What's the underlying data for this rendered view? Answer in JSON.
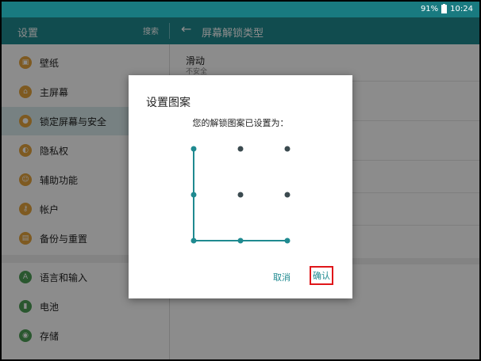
{
  "status": {
    "battery": "91%",
    "time": "10:24"
  },
  "topbar": {
    "title": "设置",
    "search": "搜索",
    "back_icon": "←",
    "page_title": "屏幕解锁类型"
  },
  "sidebar": {
    "items": [
      {
        "label": "壁纸",
        "icon": "wallpaper-icon",
        "color": "#e5a43c"
      },
      {
        "label": "主屏幕",
        "icon": "home-icon",
        "color": "#e5a43c"
      },
      {
        "label": "锁定屏幕与安全",
        "icon": "lock-icon",
        "color": "#e5a43c",
        "selected": true
      },
      {
        "label": "隐私权",
        "icon": "privacy-icon",
        "color": "#e5a43c"
      },
      {
        "label": "辅助功能",
        "icon": "accessibility-icon",
        "color": "#e5a43c"
      },
      {
        "label": "帐户",
        "icon": "key-icon",
        "color": "#e5a43c"
      },
      {
        "label": "备份与重置",
        "icon": "backup-icon",
        "color": "#e5a43c"
      },
      {
        "label": "语言和输入",
        "icon": "language-icon",
        "color": "#4d9e56"
      },
      {
        "label": "电池",
        "icon": "battery-icon",
        "color": "#4d9e56"
      },
      {
        "label": "存储",
        "icon": "storage-icon",
        "color": "#4d9e56"
      }
    ]
  },
  "content": {
    "options": [
      {
        "title": "滑动",
        "subtitle": "不安全"
      }
    ]
  },
  "dialog": {
    "title": "设置图案",
    "message": "您的解锁图案已设置为：",
    "cancel_label": "取消",
    "ok_label": "确认",
    "pattern_path": [
      1,
      4,
      7,
      8,
      9
    ]
  },
  "colors": {
    "accent": "#1f8a90",
    "highlight": "#e0161a"
  }
}
